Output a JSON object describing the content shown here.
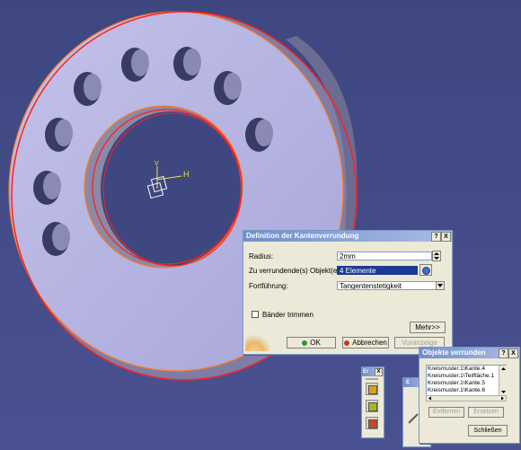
{
  "edge_fillet_dialog": {
    "title": "Definition der Kantenverrundung",
    "help_label": "?",
    "close_label": "X",
    "radius_label": "Radius:",
    "radius_value": "2mm",
    "objects_label": "Zu verrundende(s) Objekt(e):",
    "objects_value": "4 Elemente",
    "propagation_label": "Fortführung:",
    "propagation_value": "Tangentenstetigkeit",
    "trim_ribbons_label": "Bänder trimmen",
    "more_label": "Mehr>>",
    "ok_label": "OK",
    "cancel_label": "Abbrechen",
    "preview_label": "Voranzeige"
  },
  "objects_dialog": {
    "title": "Objekte verrunden",
    "help_label": "?",
    "close_label": "X",
    "items": [
      "Kreismuster.1\\Kante.4",
      "Kreismuster.1\\Teilfläche.1",
      "Kreismuster.1\\Kante.5",
      "Kreismuster.1\\Kante.6"
    ],
    "remove_label": "Entfernen",
    "replace_label": "Ersetzen",
    "close_button_label": "Schließen"
  },
  "toolbar": {
    "title": "Er",
    "close_label": "X"
  },
  "toolbar2": {
    "title": "E"
  },
  "viewport": {
    "axis_h_label": "H",
    "axis_v_label": "V",
    "colors": {
      "background": "#3d4781",
      "part": "#b8b7e3",
      "selection": "#ff2020",
      "preview": "#ff7a1a"
    }
  }
}
